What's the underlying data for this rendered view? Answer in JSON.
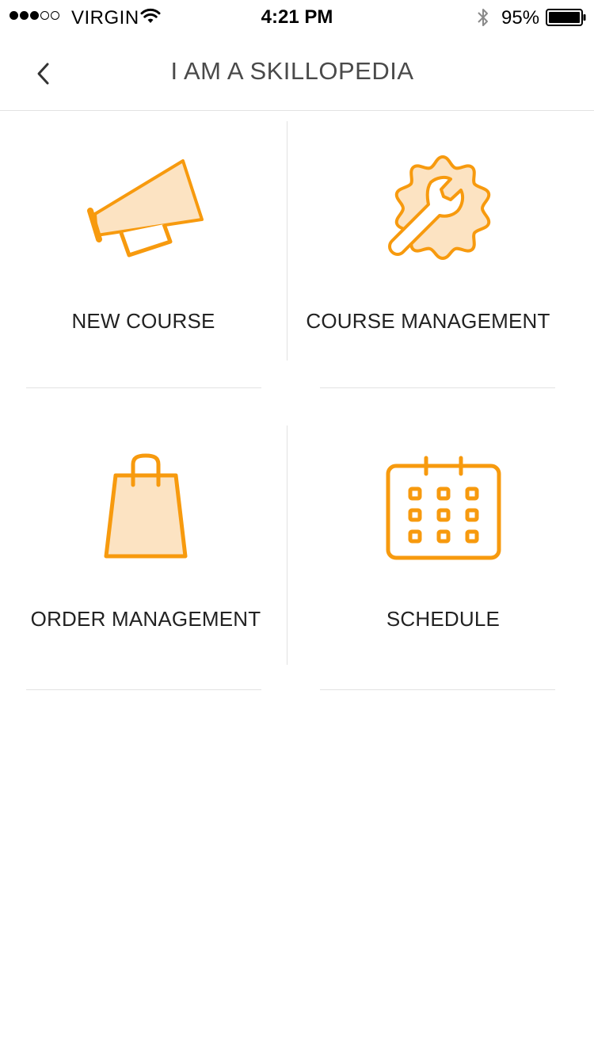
{
  "status_bar": {
    "carrier": "VIRGIN",
    "time": "4:21 PM",
    "battery_percent": "95%",
    "signal_bars_filled": 3,
    "signal_bars_total": 5
  },
  "nav": {
    "title": "I AM A SKILLOPEDIA",
    "back_icon": "chevron-left-icon"
  },
  "menu": {
    "accent_color": "#F79A0E",
    "accent_fill_color": "#FCE3C2",
    "items": [
      {
        "label": "NEW COURSE",
        "icon": "megaphone-icon"
      },
      {
        "label": "COURSE MANAGEMENT",
        "icon": "gear-wrench-icon"
      },
      {
        "label": "ORDER MANAGEMENT",
        "icon": "shopping-bag-icon"
      },
      {
        "label": "SCHEDULE",
        "icon": "calendar-icon"
      }
    ]
  }
}
